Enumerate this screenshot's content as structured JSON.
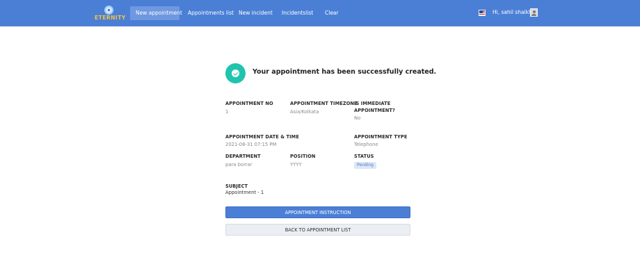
{
  "header": {
    "logo_text": "ETERNITY",
    "nav": [
      {
        "label": "New appointment",
        "active": true
      },
      {
        "label": "Appointments list",
        "active": false
      },
      {
        "label": "New incident",
        "active": false
      },
      {
        "label": "Incidentslist",
        "active": false
      },
      {
        "label": "Clear",
        "active": false
      }
    ],
    "greeting": "Hi, sahil shaikh"
  },
  "confirmation": {
    "title": "Your appointment has been successfully created."
  },
  "fields": {
    "appointment_no": {
      "label": "APPOINTMENT NO",
      "value": "1"
    },
    "appointment_timezone": {
      "label": "APPOINTMENT TIMEZONE",
      "value": "Asia/Kolkata"
    },
    "is_immediate": {
      "label": "IS IMMEDIATE APPOINTMENT?",
      "value": "No"
    },
    "date_time": {
      "label": "APPOINTMENT DATE & TIME",
      "value": "2021-08-31 07:15 PM"
    },
    "appointment_type": {
      "label": "APPOINTMENT TYPE",
      "value": "Telephone"
    },
    "department": {
      "label": "DEPARTMENT",
      "value": "para borrar"
    },
    "position": {
      "label": "POSITION",
      "value": "YYYY"
    },
    "status": {
      "label": "STATUS",
      "value": "Pending"
    },
    "subject": {
      "label": "SUBJECT",
      "value": "Appointment - 1"
    }
  },
  "buttons": {
    "instruction": "APPOINTMENT INSTRUCTION",
    "back": "BACK TO APPOINTMENT LIST"
  },
  "colors": {
    "header_bg": "#4b7fd6",
    "success": "#1ec4ad",
    "primary_button": "#4b7fd6",
    "status_badge_bg": "#dde7f7"
  }
}
